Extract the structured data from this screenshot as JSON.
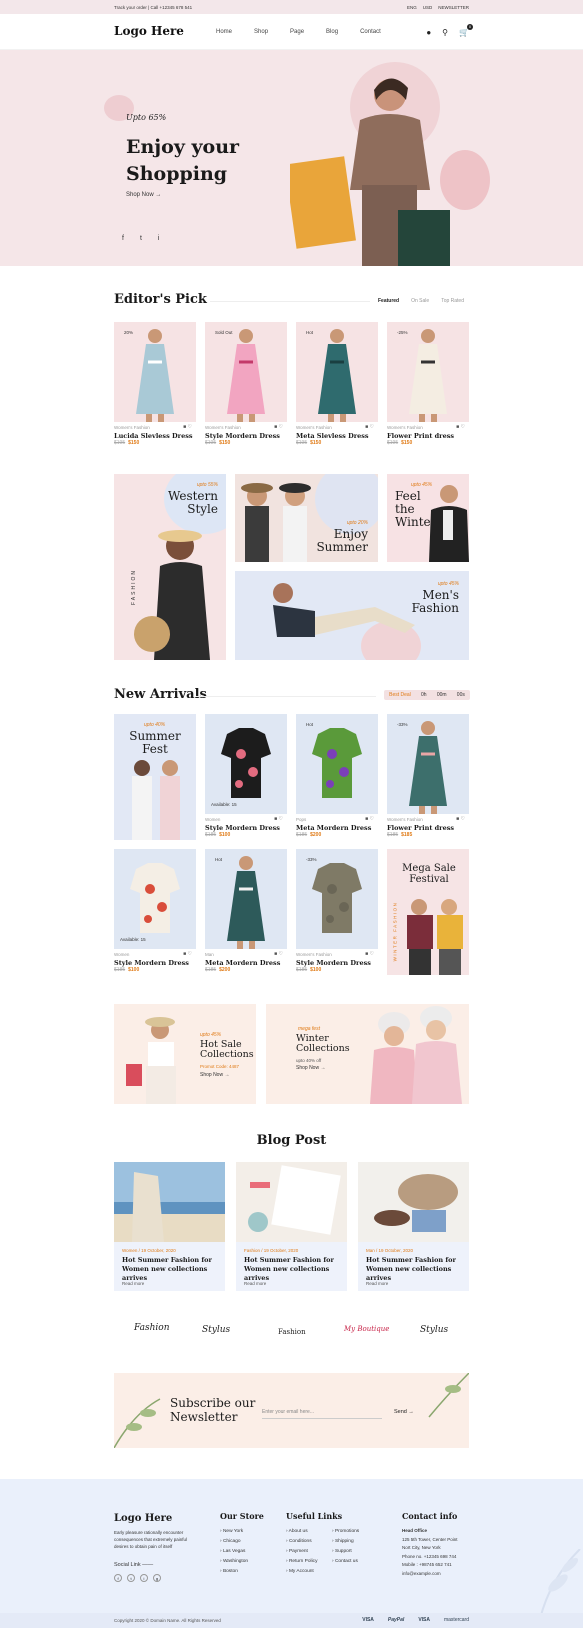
{
  "topbar": {
    "left": "Track your order  |  Call +12345 678 541",
    "right": [
      "ENG",
      "USD",
      "NEWSLETTER"
    ]
  },
  "nav": {
    "logo": "Logo Here",
    "menu": [
      "Home",
      "Shop",
      "Page",
      "Blog",
      "Contact"
    ],
    "cart_count": "0"
  },
  "hero": {
    "upto": "Upto 65%",
    "title_line1": "Enjoy your",
    "title_line2": "Shopping",
    "cta": "Shop Now",
    "social": [
      "f",
      "t",
      "i"
    ]
  },
  "editors": {
    "title": "Editor's Pick",
    "tabs": [
      "Featured",
      "On Sale",
      "Top Rated"
    ],
    "products": [
      {
        "badge": "20%",
        "category": "Women's Fashion",
        "name": "Lucida Slevless Dress",
        "old": "$195",
        "price": "$150"
      },
      {
        "badge": "Sold Out",
        "category": "Women's Fashion",
        "name": "Style Mordern Dress",
        "old": "$195",
        "price": "$150"
      },
      {
        "badge": "Hot",
        "category": "Women's Fashion",
        "name": "Meta Slevless Dress",
        "old": "$195",
        "price": "$150"
      },
      {
        "badge": "-25%",
        "category": "Women's Fashion",
        "name": "Flower Print dress",
        "old": "$195",
        "price": "$150"
      }
    ]
  },
  "promos": {
    "western": {
      "tag": "upto 55%",
      "title": "Western Style",
      "side": "FASHION"
    },
    "summer": {
      "tag": "upto 20%",
      "title": "Enjoy Summer"
    },
    "winter": {
      "tag": "upto 45%",
      "title": "Feel the Winter"
    },
    "mens": {
      "tag": "upto 45%",
      "title": "Men's Fashion"
    }
  },
  "arrivals": {
    "title": "New Arrivals",
    "timer": [
      "Best Deal",
      "0h",
      "00m",
      "00s"
    ],
    "fest": {
      "tag": "upto 40%",
      "title": "Summer Fest"
    },
    "mega": {
      "title": "Mega Sale Festival",
      "side": "WINTER FASHION"
    },
    "products": [
      {
        "badge": "",
        "avail": "Available: 15",
        "category": "Women",
        "name": "Style Mordern Dress",
        "old": "$185",
        "price": "$100"
      },
      {
        "badge": "Hot",
        "avail": "",
        "category": "Pops",
        "name": "Meta Mordern Dress",
        "old": "$185",
        "price": "$200"
      },
      {
        "badge": "-33%",
        "avail": "",
        "category": "Women's Fashion",
        "name": "Flower Print dress",
        "old": "$185",
        "price": "$185"
      },
      {
        "badge": "",
        "avail": "Available: 15",
        "category": "Women",
        "name": "Style Mordern Dress",
        "old": "$185",
        "price": "$100"
      },
      {
        "badge": "Hot",
        "avail": "",
        "category": "Man",
        "name": "Meta Mordern Dress",
        "old": "$185",
        "price": "$200"
      },
      {
        "badge": "-33%",
        "avail": "",
        "category": "Women's Fashion",
        "name": "Style Mordern Dress",
        "old": "$185",
        "price": "$100"
      }
    ]
  },
  "banners": {
    "hot": {
      "tag": "upto 45%",
      "title": "Hot Sale Collections",
      "code": "Promot Code: 4487",
      "cta": "Shop Now"
    },
    "winter": {
      "tag": "mega fest",
      "title": "Winter Collections",
      "sub": "upto 40% off",
      "cta": "Shop Now"
    }
  },
  "blog": {
    "title": "Blog Post",
    "posts": [
      {
        "meta": "Women  /  19 October, 2020",
        "title": "Hot Summer Fashion for Women new collections arrives",
        "more": "Read more"
      },
      {
        "meta": "Fashion  /  19 October, 2020",
        "title": "Hot Summer Fashion for Women new collections arrives",
        "more": "Read more"
      },
      {
        "meta": "Man  /  19 October, 2020",
        "title": "Hot Summer Fashion for Women new collections arrives",
        "more": "Read more"
      }
    ]
  },
  "brands": [
    "Fashion",
    "Stylus",
    "Fashion",
    "My Boutique",
    "Stylus"
  ],
  "subscribe": {
    "title_line1": "Subscribe our",
    "title_line2": "Newsletter",
    "placeholder": "Enter your email here...",
    "button": "Send"
  },
  "footer": {
    "logo": "Logo Here",
    "about": "Early pleasure rationally encounter consequences that extremely painful desires to obtain pain of itself",
    "social_label": "Social Link",
    "store_title": "Our Store",
    "stores": [
      "New York",
      "Chicago",
      "Las Vegas",
      "Washington",
      "Boston"
    ],
    "links_title": "Useful Links",
    "links_a": [
      "About us",
      "Conditions",
      "Payment",
      "Return Policy",
      "My Account"
    ],
    "links_b": [
      "Promotions",
      "Shipping",
      "Support",
      "Contact us"
    ],
    "contact_title": "Contact info",
    "contact": [
      "Head Office",
      "125 5th Tower, Center Point",
      "Nort City, New York",
      "Phone no. +12345 698 744",
      "Mobile : +98745 652 741",
      "info@example.com"
    ],
    "copyright": "Copyright 2020 © Domain Name. All Rights Reserved",
    "payments": [
      "VISA",
      "PayPal",
      "VISA",
      "mastercard"
    ]
  }
}
